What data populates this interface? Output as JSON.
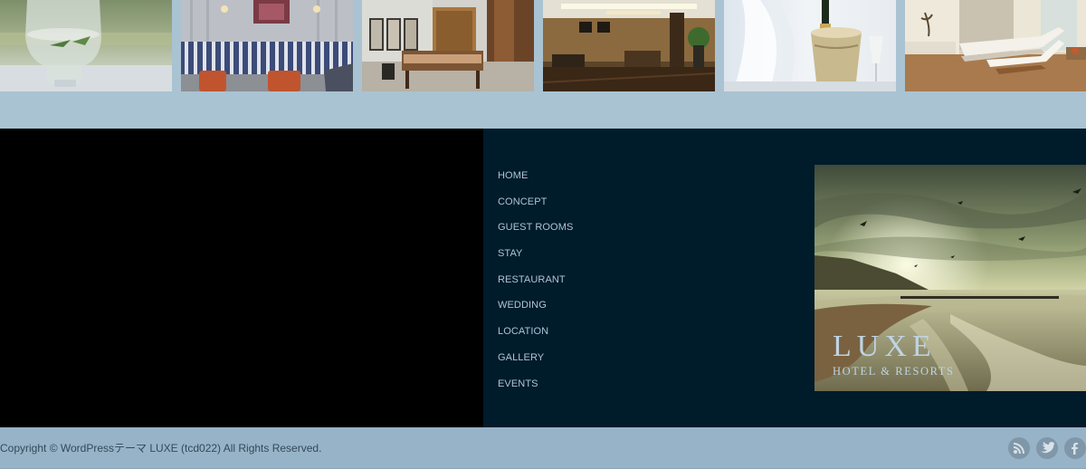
{
  "gallery": {
    "images": [
      {
        "name": "water-glass-photo"
      },
      {
        "name": "lounge-sofa-photo"
      },
      {
        "name": "guest-room-photo"
      },
      {
        "name": "hotel-lobby-photo"
      },
      {
        "name": "champagne-bucket-photo"
      },
      {
        "name": "spa-loungers-photo"
      }
    ]
  },
  "footer_nav": {
    "items": [
      {
        "label": "HOME"
      },
      {
        "label": "CONCEPT"
      },
      {
        "label": "GUEST ROOMS"
      },
      {
        "label": "STAY"
      },
      {
        "label": "RESTAURANT"
      },
      {
        "label": "WEDDING"
      },
      {
        "label": "LOCATION"
      },
      {
        "label": "GALLERY"
      },
      {
        "label": "EVENTS"
      }
    ]
  },
  "banner": {
    "title": "LUXE",
    "subtitle": "HOTEL & RESORTS"
  },
  "footer": {
    "copyright": "Copyright ©  WordPressテーマ LUXE (tcd022) All Rights Reserved."
  },
  "social": {
    "icons": [
      "rss-icon",
      "twitter-icon",
      "facebook-icon"
    ]
  },
  "colors": {
    "page_bg": "#a9c3d2",
    "nav_panel_bg": "#001b2a",
    "left_panel_bg": "#000000",
    "bottom_bar_bg": "#97b3c7",
    "nav_text": "#aac6d8",
    "social_icon_bg": "#7f97a8"
  }
}
